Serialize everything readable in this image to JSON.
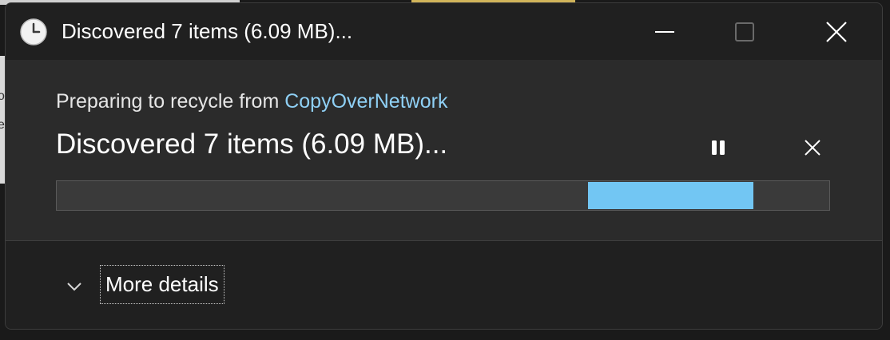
{
  "window": {
    "title": "Discovered 7 items (6.09 MB)...",
    "icon": "clock-icon"
  },
  "caption_buttons": {
    "minimize": "minimize-icon",
    "maximize": "maximize-icon",
    "close": "close-icon"
  },
  "operation": {
    "prefix": "Preparing to recycle from ",
    "source": "CopyOverNetwork",
    "status": "Discovered 7 items (6.09 MB)...",
    "pause_icon": "pause-icon",
    "cancel_icon": "close-icon",
    "progress": {
      "mode": "indeterminate",
      "indicator_start_fraction": 0.688,
      "indicator_end_fraction": 0.902,
      "color": "#72c6f3"
    }
  },
  "footer": {
    "more_details_label": "More details",
    "chevron_icon": "chevron-down-icon"
  },
  "colors": {
    "window_bg": "#2b2b2b",
    "titlebar_bg": "#202020",
    "link": "#8fd0f5",
    "accent": "#72c6f3"
  }
}
